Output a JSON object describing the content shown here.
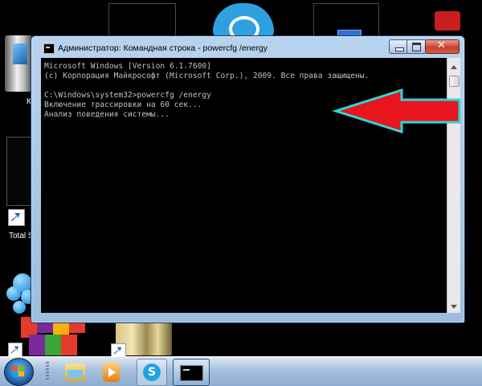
{
  "window": {
    "title": "Администратор: Командная строка - powercfg  /energy",
    "close_symbol": "✕"
  },
  "console": {
    "lines": [
      "Microsoft Windows [Version 6.1.7600]",
      "(с) Корпорация Майкрософт (Microsoft Corp.), 2009. Все права защищены.",
      "",
      "C:\\Windows\\system32>powercfg /energy",
      "Включение трассировки на 60 сек...",
      "Анализ поведения системы..."
    ]
  },
  "desktop": {
    "icon_label_computer": "Ко",
    "icon_label_total": "Total S"
  },
  "taskbar": {
    "skype_glyph": "S"
  },
  "colors": {
    "arrow_fill": "#e8141e",
    "arrow_outline": "#2fd6d8",
    "console_text": "#c0c0c0",
    "console_bg": "#000000"
  },
  "icons": [
    "cmd-icon",
    "minimize-icon",
    "maximize-icon",
    "close-icon",
    "windows-start-icon",
    "explorer-icon",
    "media-player-icon",
    "skype-icon",
    "command-prompt-icon",
    "shortcut-arrow-icon"
  ]
}
